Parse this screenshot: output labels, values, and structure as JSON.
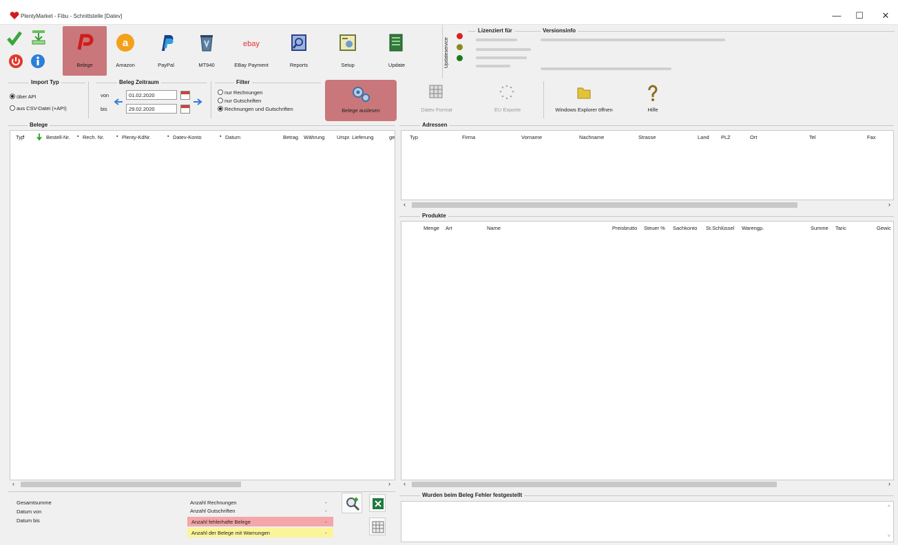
{
  "window": {
    "title": "PlentyMarket - Fibu - Schnittstelle [Datev]",
    "minimize": "—",
    "maximize": "☐",
    "close": "✕"
  },
  "toolbar": {
    "belege": "Belege",
    "amazon": "Amazon",
    "paypal": "PayPal",
    "mt940": "MT940",
    "ebay_payment": "EBay Payment",
    "reports": "Reports",
    "setup": "Setup",
    "update": "Update",
    "ebay_logo": "ebay",
    "amazon_logo": "a"
  },
  "license": {
    "updateservice": "Updateservice",
    "licensed_for": "Lizenziert für",
    "version_info": "Versionsinfo"
  },
  "import_typ": {
    "title": "Import Typ",
    "api": "über API",
    "csv": "aus CSV-Datei (+API)"
  },
  "zeitraum": {
    "title": "Beleg Zeitraum",
    "von_label": "von",
    "bis_label": "bis",
    "von": "01.02.2020",
    "bis": "29.02.2020"
  },
  "filter": {
    "title": "Filter",
    "rechnungen": "nur Rechnungen",
    "gutschriften": "nur Gutschriften",
    "beide": "Rechnungen und Gutschriften"
  },
  "actions": {
    "belege_auslesen": "Belege auslesen",
    "datev_format": "Datev Format",
    "eu_exporte": "EU Exporte",
    "windows_explorer": "Windows Explorer öffnen",
    "hilfe": "Hilfe"
  },
  "belege": {
    "title": "Belege",
    "columns": [
      "Typ",
      "Bestell-Nr.",
      "Rech. Nr.",
      "Plenty-KdNr.",
      "Datev-Konto",
      "Datum",
      "Betrag",
      "Währung",
      "Urspr. Lieferung",
      "ge"
    ]
  },
  "adressen": {
    "title": "Adressen",
    "columns": [
      "Typ",
      "Firma",
      "Vorname",
      "Nachname",
      "Strasse",
      "Land",
      "PLZ",
      "Ort",
      "Tel",
      "Fax"
    ]
  },
  "produkte": {
    "title": "Produkte",
    "columns": [
      "Menge",
      "Art",
      "Name",
      "Preisbrutto",
      "Steuer %",
      "Sachkonto",
      "St.Schlüssel",
      "Warengp.",
      "Summe",
      "Taric",
      "Gewic"
    ]
  },
  "summary": {
    "gesamtsumme": "Gesamtsumme",
    "datum_von": "Datum von",
    "datum_bis": "Datum bis",
    "anzahl_rechnungen": "Anzahl Rechnungen",
    "anzahl_gutschriften": "Anzahl Gutschriften",
    "anzahl_fehlerhaft": "Anzahl fehlerhafte Belege",
    "anzahl_warnungen": "Anzahl der Belege mit Warnungen",
    "dash": "-"
  },
  "fehler": {
    "title": "Wurden beim Beleg Fehler festgestellt"
  },
  "colors": {
    "active": "#c9777a",
    "error_row": "#f4a6a8",
    "warning_row": "#fbf59a"
  }
}
